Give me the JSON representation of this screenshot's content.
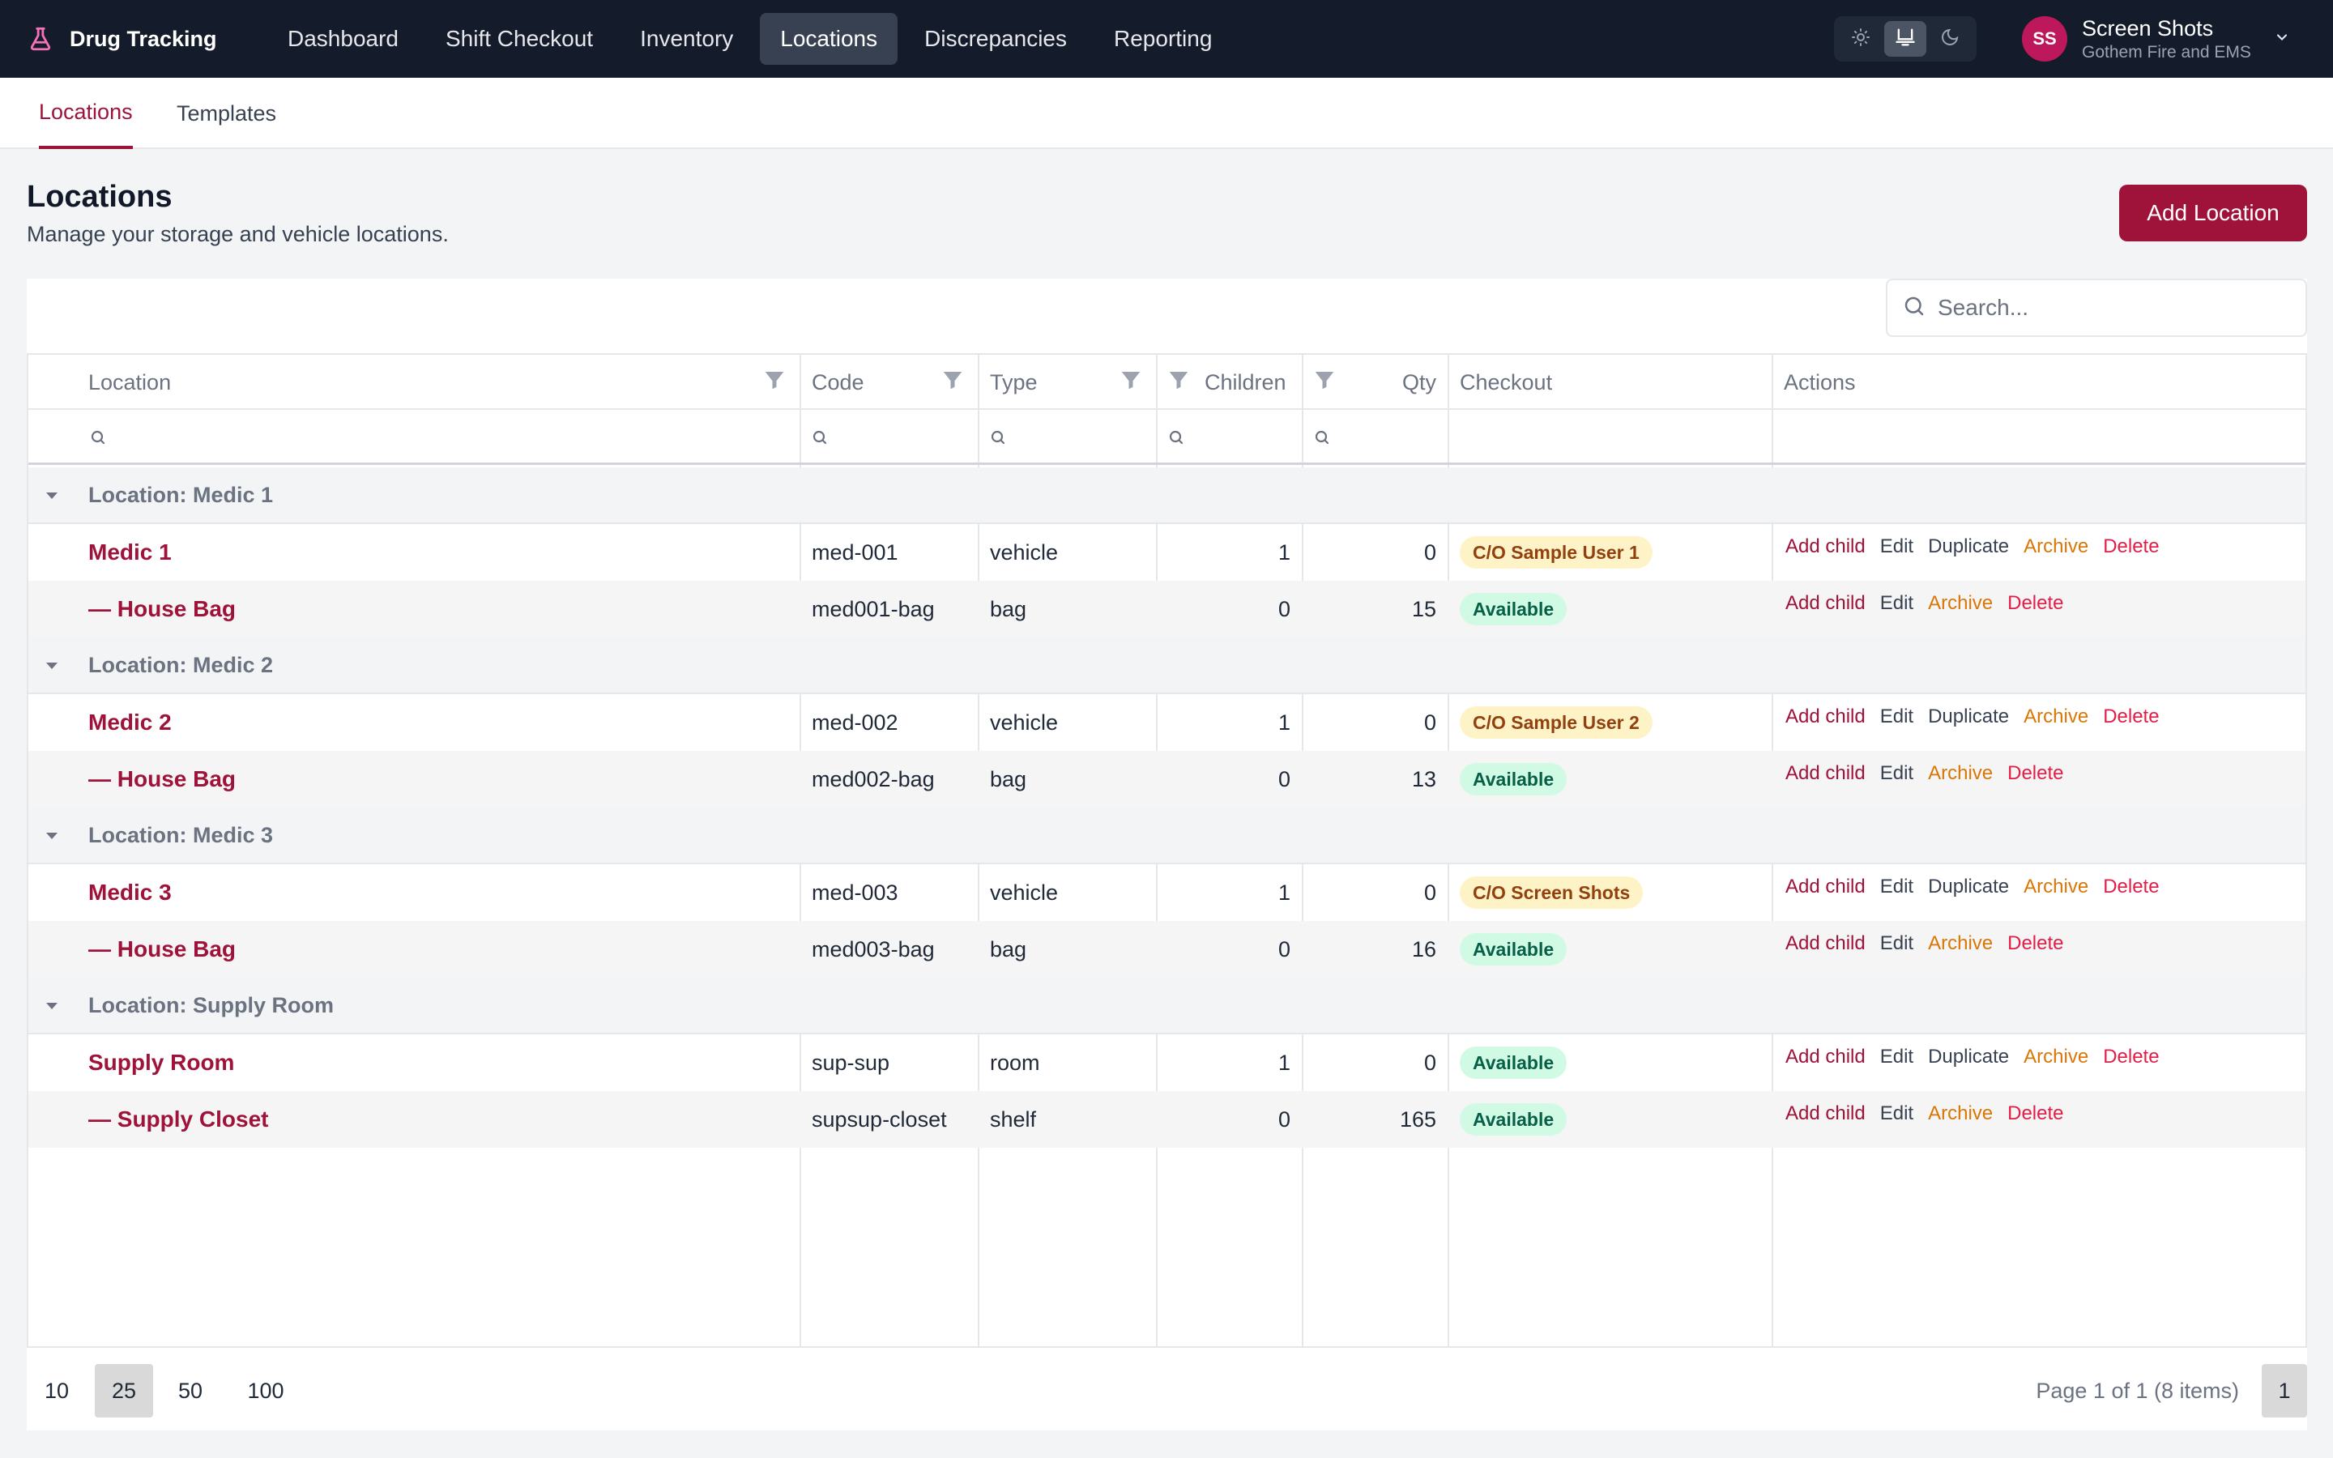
{
  "app": {
    "brand": "Drug Tracking",
    "nav": [
      {
        "label": "Dashboard",
        "active": false
      },
      {
        "label": "Shift Checkout",
        "active": false
      },
      {
        "label": "Inventory",
        "active": false
      },
      {
        "label": "Locations",
        "active": true
      },
      {
        "label": "Discrepancies",
        "active": false
      },
      {
        "label": "Reporting",
        "active": false
      }
    ],
    "theme_mode": "system",
    "user": {
      "initials": "SS",
      "name": "Screen Shots",
      "org": "Gothem Fire and EMS"
    }
  },
  "subtabs": [
    {
      "label": "Locations",
      "active": true
    },
    {
      "label": "Templates",
      "active": false
    }
  ],
  "page": {
    "title": "Locations",
    "subtitle": "Manage your storage and vehicle locations.",
    "add_button": "Add Location",
    "search_placeholder": "Search..."
  },
  "table": {
    "columns": [
      "Location",
      "Code",
      "Type",
      "Children",
      "Qty",
      "Checkout",
      "Actions"
    ],
    "groups": [
      {
        "label": "Location: Medic 1",
        "rows": [
          {
            "location": "Medic 1",
            "code": "med-001",
            "type": "vehicle",
            "children": "1",
            "qty": "0",
            "checkout": "C/O Sample User 1",
            "status": "checked-out",
            "actions": [
              "Add child",
              "Edit",
              "Duplicate",
              "Archive",
              "Delete"
            ]
          },
          {
            "location": "— House Bag",
            "code": "med001-bag",
            "type": "bag",
            "children": "0",
            "qty": "15",
            "checkout": "Available",
            "status": "available",
            "actions": [
              "Add child",
              "Edit",
              "Archive",
              "Delete"
            ]
          }
        ]
      },
      {
        "label": "Location: Medic 2",
        "rows": [
          {
            "location": "Medic 2",
            "code": "med-002",
            "type": "vehicle",
            "children": "1",
            "qty": "0",
            "checkout": "C/O Sample User 2",
            "status": "checked-out",
            "actions": [
              "Add child",
              "Edit",
              "Duplicate",
              "Archive",
              "Delete"
            ]
          },
          {
            "location": "— House Bag",
            "code": "med002-bag",
            "type": "bag",
            "children": "0",
            "qty": "13",
            "checkout": "Available",
            "status": "available",
            "actions": [
              "Add child",
              "Edit",
              "Archive",
              "Delete"
            ]
          }
        ]
      },
      {
        "label": "Location: Medic 3",
        "rows": [
          {
            "location": "Medic 3",
            "code": "med-003",
            "type": "vehicle",
            "children": "1",
            "qty": "0",
            "checkout": "C/O Screen Shots",
            "status": "checked-out",
            "actions": [
              "Add child",
              "Edit",
              "Duplicate",
              "Archive",
              "Delete"
            ]
          },
          {
            "location": "— House Bag",
            "code": "med003-bag",
            "type": "bag",
            "children": "0",
            "qty": "16",
            "checkout": "Available",
            "status": "available",
            "actions": [
              "Add child",
              "Edit",
              "Archive",
              "Delete"
            ]
          }
        ]
      },
      {
        "label": "Location: Supply Room",
        "rows": [
          {
            "location": "Supply Room",
            "code": "sup-sup",
            "type": "room",
            "children": "1",
            "qty": "0",
            "checkout": "Available",
            "status": "available",
            "actions": [
              "Add child",
              "Edit",
              "Duplicate",
              "Archive",
              "Delete"
            ]
          },
          {
            "location": "— Supply Closet",
            "code": "supsup-closet",
            "type": "shelf",
            "children": "0",
            "qty": "165",
            "checkout": "Available",
            "status": "available",
            "actions": [
              "Add child",
              "Edit",
              "Archive",
              "Delete"
            ]
          }
        ]
      }
    ]
  },
  "pager": {
    "sizes": [
      "10",
      "25",
      "50",
      "100"
    ],
    "active_size": "25",
    "info": "Page 1 of 1 (8 items)",
    "current_page": "1"
  },
  "colors": {
    "nav_bg": "#141b2b",
    "accent": "#9f1239",
    "archive": "#d97706",
    "delete": "#e11d48",
    "checkout_badge_bg": "#fef3c7",
    "available_badge_bg": "#d1fae5"
  }
}
